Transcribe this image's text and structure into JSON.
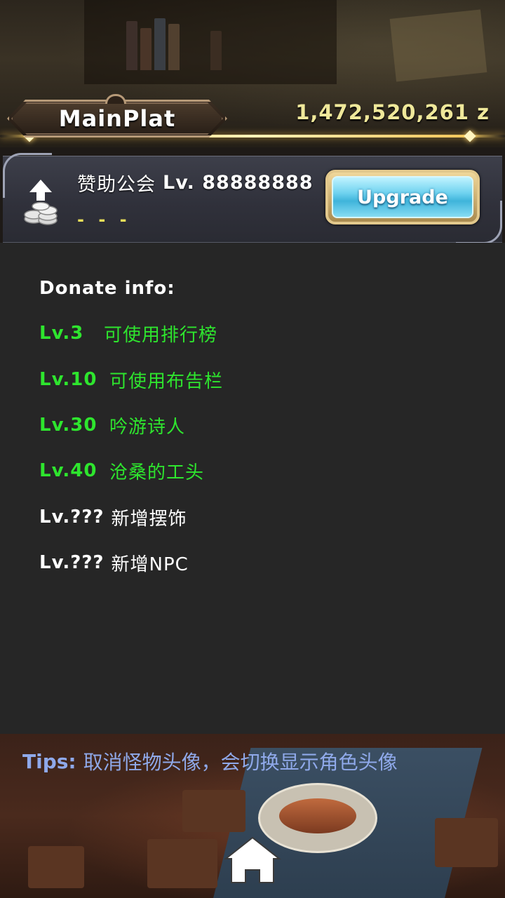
{
  "header": {
    "title": "MainPlat",
    "currency": "1,472,520,261 z"
  },
  "level_panel": {
    "guild_label": "赞助公会",
    "level_text": "Lv. 88888888",
    "progress": "- - -",
    "upgrade_label": "Upgrade",
    "icon": "upgrade-coins-icon"
  },
  "donate_info": {
    "title": "Donate info:",
    "rows": [
      {
        "level": "Lv.3",
        "reward": "可使用排行榜",
        "unlocked": true
      },
      {
        "level": "Lv.10",
        "reward": "可使用布告栏",
        "unlocked": true
      },
      {
        "level": "Lv.30",
        "reward": "吟游诗人",
        "unlocked": true
      },
      {
        "level": "Lv.40",
        "reward": "沧桑的工头",
        "unlocked": true
      },
      {
        "level": "Lv.???",
        "reward": "新增摆饰",
        "unlocked": false
      },
      {
        "level": "Lv.???",
        "reward": "新增NPC",
        "unlocked": false
      }
    ]
  },
  "tips": {
    "label": "Tips:",
    "text": "取消怪物头像，会切换显示角色头像"
  },
  "colors": {
    "unlocked": "#2ee52e",
    "locked": "#ffffff",
    "currency": "#efe89a",
    "tips": "#8fa9ea"
  },
  "nav": {
    "home_icon": "home-icon"
  }
}
